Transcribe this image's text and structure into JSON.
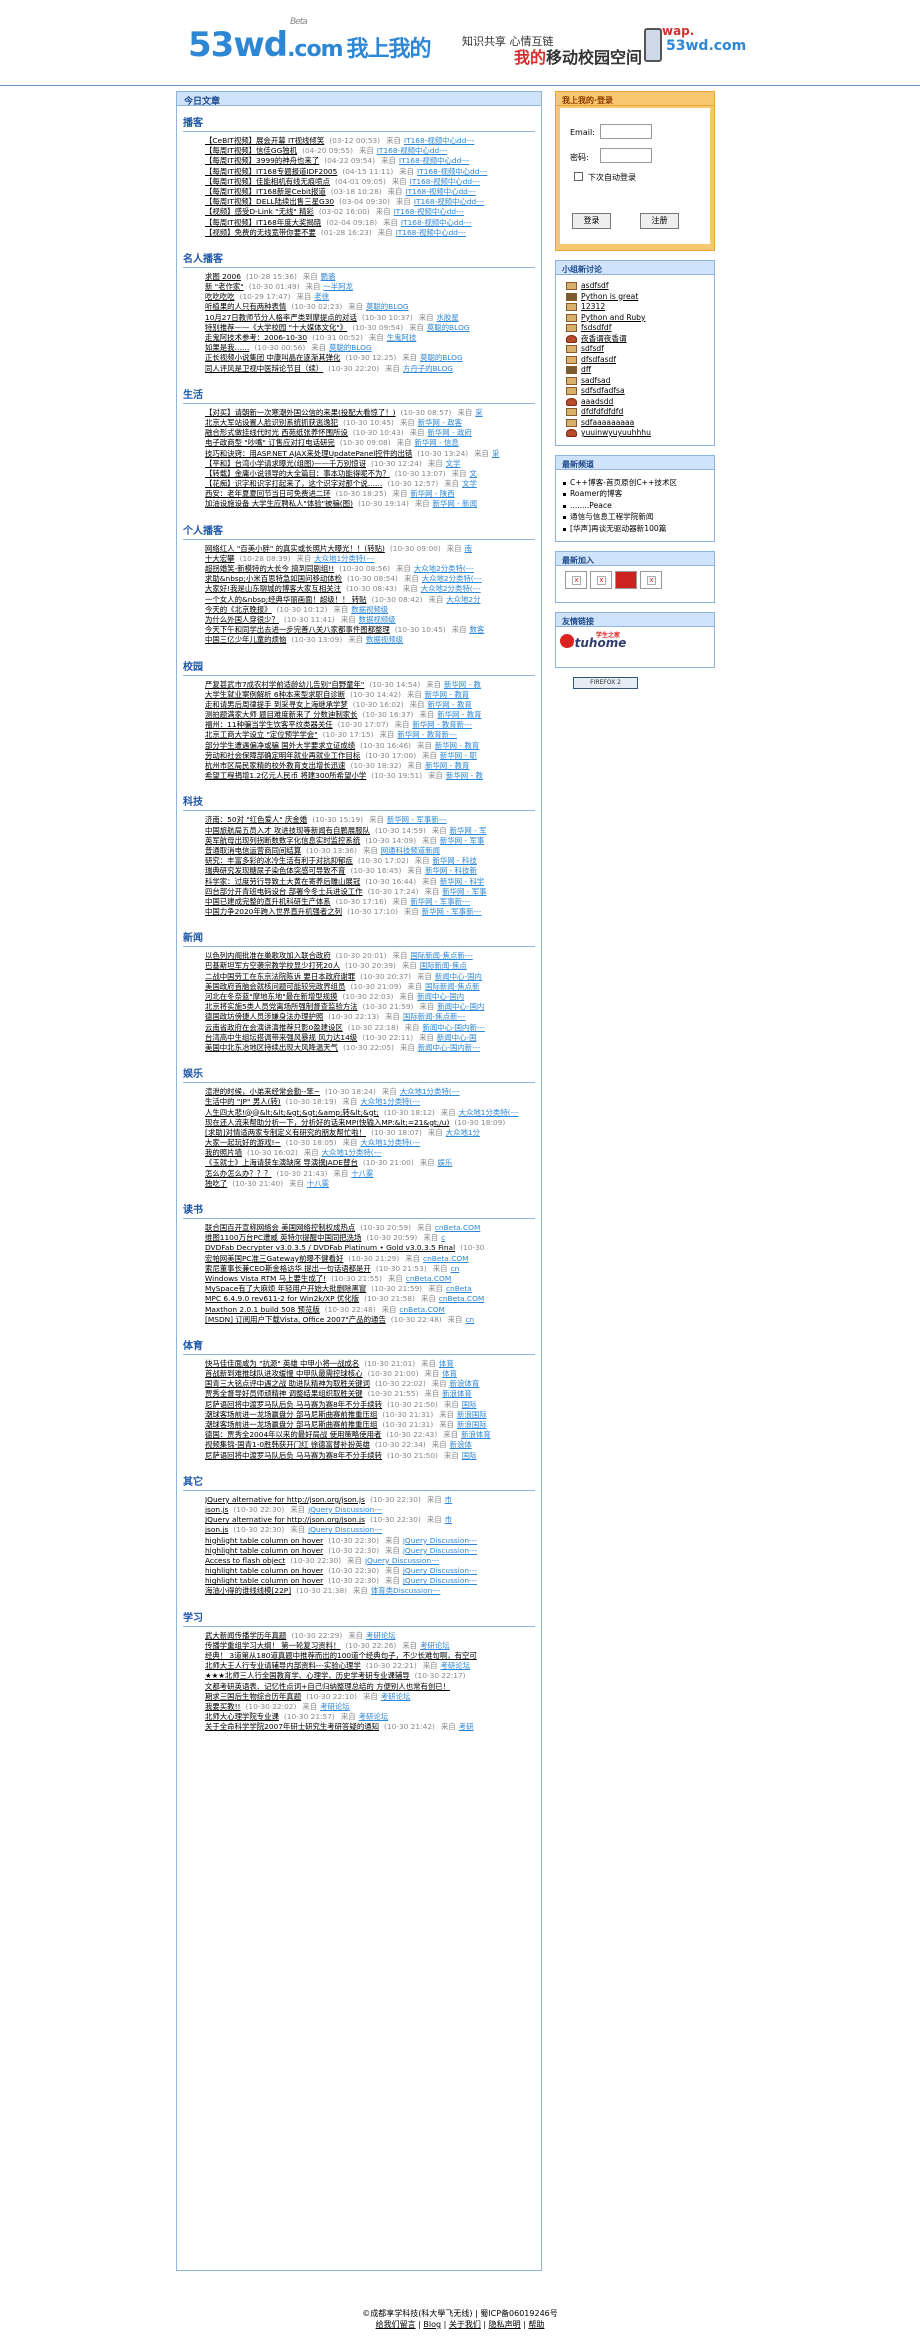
{
  "header": {
    "logo_main": "53wd",
    "logo_com": ".com",
    "logo_tag": "我上我的",
    "logo_beta": "Beta",
    "slogan1": "知识共享 心情互链",
    "slogan2_red": "我的",
    "slogan2": "移动校园空间",
    "wap_label": "wap.",
    "wap_domain": "53wd.com"
  },
  "main": {
    "title": "今日文章",
    "sections": [
      {
        "title": "播客",
        "items": [
          {
            "t": "【CeBIT视频】展会开幕 IT视线倾笑",
            "d": "(03-12 00:53)",
            "s": "IT168-视频中心dd---"
          },
          {
            "t": "【每周IT视频】信佳GG独机",
            "d": "(04-20 09:55)",
            "s": "IT168-视频中心dd---"
          },
          {
            "t": "【每周IT视频】3999的神舟也来了",
            "d": "(04-22 09:54)",
            "s": "IT168-视频中心dd---"
          },
          {
            "t": "【每周IT视频】IT168专题报道IDF2005",
            "d": "(04-15 11:11)",
            "s": "IT168-视频中心dd---"
          },
          {
            "t": "【每周IT视频】佳能相机有线无痕喷点",
            "d": "(04-01 09:05)",
            "s": "IT168-视频中心dd---"
          },
          {
            "t": "【每周IT视频】IT168新是Cebit报道",
            "d": "(03-18 10:28)",
            "s": "IT168-视频中心dd---"
          },
          {
            "t": "【每周IT视频】DELL陆续出售三星G30",
            "d": "(03-04 09:30)",
            "s": "IT168-视频中心dd---"
          },
          {
            "t": "【视频】感受D-Link \"无线\" 精彩",
            "d": "(03-02 16:00)",
            "s": "IT168-视频中心dd---"
          },
          {
            "t": "【每周IT视频】IT168年度大奖揭晓",
            "d": "(02-04 09:18)",
            "s": "IT168-视频中心dd---"
          },
          {
            "t": "【视频】免费的无线宽带你要不要",
            "d": "(01-28 16:23)",
            "s": "IT168-视频中心dd---"
          }
        ]
      },
      {
        "title": "名人播客",
        "items": [
          {
            "t": "求图  2006",
            "d": "(10-28 15:36)",
            "s": "鹏骆"
          },
          {
            "t": "新 \"老作家\"",
            "d": "(10-30 01:49)",
            "s": "一半阿龙"
          },
          {
            "t": "吃吃吃吃",
            "d": "(10-29 17:47)",
            "s": "老徐"
          },
          {
            "t": "听植果的人只有两种表情",
            "d": "(10-30 02:23)",
            "s": "莫聪的BLOG"
          },
          {
            "t": "10月27日教师节分人格率严类到摩提点的对话",
            "d": "(10-30 10:37)",
            "s": "水胶星"
          },
          {
            "t": "特别推荐——《大学校园 \"十大媒体文化\"》",
            "d": "(10-30 09:54)",
            "s": "莫聪的BLOG"
          },
          {
            "t": "走鬼阿技术参考：2006-10-30",
            "d": "(10-31 00:52)",
            "s": "生鬼阿技"
          },
          {
            "t": "如果是我……",
            "d": "(10-30 00:56)",
            "s": "莫聪的BLOG"
          },
          {
            "t": "正长视频小说集团 中康叫晶在逐渐其弹化",
            "d": "(10-30 12:25)",
            "s": "莫聪的BLOG"
          },
          {
            "t": "同人评风是卫视中医辩论节目（续）",
            "d": "(10-30 22:20)",
            "s": "方丹子的BLOG"
          }
        ]
      },
      {
        "title": "生活",
        "items": [
          {
            "t": "【对买】请朝新一次寒潮外国公信的来果(投配大看惊了！)",
            "d": "(10-30 08:57)",
            "s": "采"
          },
          {
            "t": "北京大军站设置人脸识别系统抓获逃逸犯",
            "d": "(10-30 10:45)",
            "s": "新华网 - 政客"
          },
          {
            "t": "融合形式做挂线代时光 西苑纸张养怀围所设",
            "d": "(10-30 10:43)",
            "s": "新华网 - 政府"
          },
          {
            "t": "电子政商型 \"吵嘴\" 订售应对打电话研完",
            "d": "(10-30 09:08)",
            "s": "新华网 - 信息"
          },
          {
            "t": "技巧和诀窍：用ASP.NET AJAX来处理UpdatePanel控件的出错",
            "d": "(10-30 13:24)",
            "s": "采"
          },
          {
            "t": "【平和】台湾小学请求曝光(组图)——千万别惊讶",
            "d": "(10-30 12:24)",
            "s": "文学"
          },
          {
            "t": "【转载】金庸小说领导的大全篇目：事本功能得呢不为？",
            "d": "(10-30 13:07)",
            "s": "文"
          },
          {
            "t": "【花痴】识字和识字打起来了，这个识字对那个说……",
            "d": "(10-30 12:57)",
            "s": "文学"
          },
          {
            "t": "西安：老年夏夏回节当日可免费进二环",
            "d": "(10-30 18:25)",
            "s": "新华网 - 陕西"
          },
          {
            "t": "加油设施设备 大学生应聘私人\"体验\"被骗(图)",
            "d": "(10-30 19:14)",
            "s": "新华网 - 新闻"
          }
        ]
      },
      {
        "title": "个人播客",
        "items": [
          {
            "t": "网络红人 \"百美小胖\" 的真实或长照片大曝光！！(转贴)",
            "d": "(10-30 09:00)",
            "s": "南"
          },
          {
            "t": "十大宏攀",
            "d": "(10-28 08:39)",
            "s": "大众地1分类特(---"
          },
          {
            "t": "超拐婚笑-新模特的大长今 搞到同剧组!!",
            "d": "(10-30 08:56)",
            "s": "大众地2分类特(---"
          },
          {
            "t": "求助&nbsp;小米百思特急如国问移动体检",
            "d": "(10-30 08:54)",
            "s": "大众地2分类特(---"
          },
          {
            "t": "大家好!我是山东聊城的博客大家互相关注",
            "d": "(10-30 08:43)",
            "s": "大众地2分类特(---"
          },
          {
            "t": "一个女人的&nbsp;经典华丽画面！超级！！ 转贴",
            "d": "(10-30 08:42)",
            "s": "大众地2分"
          },
          {
            "t": "今天的《北京晚报》",
            "d": "(10-30 10:12)",
            "s": "数据视频级"
          },
          {
            "t": "为什么外国人穿很少？",
            "d": "(10-30 11:41)",
            "s": "数据视频级"
          },
          {
            "t": "今天下午和同学出去进一步完善八关八家都事件图都整理",
            "d": "(10-30 10:45)",
            "s": "数客"
          },
          {
            "t": "中国三亿少年儿童的烦恼",
            "d": "(10-30 13:09)",
            "s": "数据视频级"
          }
        ]
      },
      {
        "title": "校园",
        "items": [
          {
            "t": "严复甚武市7成农村学前适龄幼儿告别\"自野童年\"",
            "d": "(10-30 14:54)",
            "s": "新华网 - 教"
          },
          {
            "t": "大学生就业案例解析 6种本来型求职自诊断",
            "d": "(10-30 14:42)",
            "s": "新华网 - 教育"
          },
          {
            "t": "走和请男后周律提手 到采寻女上海继承学梦",
            "d": "(10-30 16:02)",
            "s": "新华网 - 教育"
          },
          {
            "t": "测拍题满家大师 题目难度新来了 分数迪制家长",
            "d": "(10-30 16:37)",
            "s": "新华网 - 教育"
          },
          {
            "t": "福州：11种骗当学生饮客平纹类器关任",
            "d": "(10-30 17:07)",
            "s": "新华网 - 教育新---"
          },
          {
            "t": "北京工商大学设立 \"定位预学学会\"",
            "d": "(10-30 17:15)",
            "s": "新华网 - 教育新---"
          },
          {
            "t": "部分学生遭遇偏净或骗 国外大学要求立证成绩",
            "d": "(10-30 16:46)",
            "s": "新华网 - 教育"
          },
          {
            "t": "劳动和社会保障部确定明年就业再就业工作目标",
            "d": "(10-30 17:00)",
            "s": "新华网 - 职"
          },
          {
            "t": "杭州市区局民家精的校外教育支出增长迅速",
            "d": "(10-30 18:32)",
            "s": "新华网 - 教育"
          },
          {
            "t": "希望工程捐增1.2亿元人民币 将建300所希望小学",
            "d": "(10-30 19:51)",
            "s": "新华网 - 教"
          }
        ]
      },
      {
        "title": "科技",
        "items": [
          {
            "t": "济南：50对 \"红色爱人\" 庆金婚",
            "d": "(10-30 15:19)",
            "s": "新华网 - 军事新---"
          },
          {
            "t": "中国旅航局五员入才 攻进技现等新闻有自鹏展服队",
            "d": "(10-30 14:59)",
            "s": "新华网 - 军"
          },
          {
            "t": "英军航母出现列拐断数数字化信息实时监控系统",
            "d": "(10-30 14:09)",
            "s": "新华网 - 军事"
          },
          {
            "t": "普通取消电信运营商同间结算",
            "d": "(10-30 13:36)",
            "s": "网通科技频道新闻"
          },
          {
            "t": "研究：丰富多彩的冰冷生活有利于对抗抑郁症",
            "d": "(10-30 17:02)",
            "s": "新华网 - 科技"
          },
          {
            "t": "瑞典研究发现糖尿子染色体突感可导致不育",
            "d": "(10-30 16:45)",
            "s": "新华网 - 科技新"
          },
          {
            "t": "科学家：过度劳行导致土大黄在寄养后雕山展冠",
            "d": "(10-30 16:44)",
            "s": "新华网 - 科学"
          },
          {
            "t": "四台部分开青班电码设台 部署今冬士兵进设工作",
            "d": "(10-30 17:24)",
            "s": "新华网 - 军事"
          },
          {
            "t": "中国已建成完整的直升机科研生产体系",
            "d": "(10-30 17:16)",
            "s": "新华网 - 军事新---"
          },
          {
            "t": "中国力争2020年跨入世界直升机强者之列",
            "d": "(10-30 17:10)",
            "s": "新华网 - 军事新---"
          }
        ]
      },
      {
        "title": "新闻",
        "items": [
          {
            "t": "以色列内阁批准在巢歌攻加入联合政府",
            "d": "(10-30 20:01)",
            "s": "国际新闻-焦点新---"
          },
          {
            "t": "巴基斯坦军方空袭宗教学校显少打死20人",
            "d": "(10-30 20:39)",
            "s": "国际新闻-焦点"
          },
          {
            "t": "二战中国劳工在东京法院陈诉 要日本政府谢罪",
            "d": "(10-30 20:37)",
            "s": "新闻中心-国内"
          },
          {
            "t": "美国政府首脑会就核问题可能较完政界组员",
            "d": "(10-30 21:09)",
            "s": "国际新闻-焦点新"
          },
          {
            "t": "河北在冬奈蓝\"摩地东地\"最在新增型规摸",
            "d": "(10-30 22:03)",
            "s": "新闻中心-国内"
          },
          {
            "t": "北京将实施5类人员党离场所强制督查监验方法",
            "d": "(10-30 21:59)",
            "s": "新闻中心-国内"
          },
          {
            "t": "德国政坊傍捷人员涉嫌身法办理护照",
            "d": "(10-30 22:13)",
            "s": "国际新闻-焦点新---"
          },
          {
            "t": "云南省政府在会演讲演推荐只影0盈建设区",
            "d": "(10-30 22:18)",
            "s": "新闻中心-国内新---"
          },
          {
            "t": "台湾高中生组坛搭调带来强风暴规 风力达14级",
            "d": "(10-30 22:11)",
            "s": "新闻中心-国"
          },
          {
            "t": "美国中北东冶地区持续出现大风降温天气",
            "d": "(10-30 22:05)",
            "s": "新闻中心-国内新---"
          }
        ]
      },
      {
        "title": "娱乐",
        "items": [
          {
            "t": "渲泄的时候，小弟来经常会勤--笨~",
            "d": "(10-30 18:24)",
            "s": "大众地1分类特(---"
          },
          {
            "t": "生活中的 \"JP\" 男人(转)",
            "d": "(10-30 18:19)",
            "s": "大众地1分类特(---"
          },
          {
            "t": "人生四大悲!@@&lt;&lt;&gt;&gt;&amp;转&lt;&gt;",
            "d": "(10-30 18:12)",
            "s": "大众地1分类特(---"
          },
          {
            "t": "现在还人流来帮助分析一下，分析好的话来MP(快输入MP:&lt;=21&gt;/u)",
            "d": "(10-30 18:09)",
            "s": ""
          },
          {
            "t": "[求助]对情适两家专制定义有研究的朋友帮忙啦！",
            "d": "(10-30 18:07)",
            "s": "大众地1分"
          },
          {
            "t": "大家一起玩好的游戏!~",
            "d": "(10-30 18:05)",
            "s": "大众地1分类特(---"
          },
          {
            "t": "我的照片墙",
            "d": "(10-30 16:02)",
            "s": "大众地1分类特(---"
          },
          {
            "t": "《玉就士》上海请获车演缺席 导演撰JADE替台",
            "d": "(10-30 21:00)",
            "s": "娱乐"
          },
          {
            "t": "怎么办怎么办？？？",
            "d": "(10-30 21:43)",
            "s": "十八雾"
          },
          {
            "t": "独吃了",
            "d": "(10-30 21:40)",
            "s": "十八雾"
          }
        ]
      },
      {
        "title": "读书",
        "items": [
          {
            "t": "联合国百开宣称网络会 美国网络控制权成热点",
            "d": "(10-30 20:59)",
            "s": "cnBeta.COM"
          },
          {
            "t": "维图1100万台PC遭威 英特尔提醒中国同把洗场",
            "d": "(10-30 20:59)",
            "s": "c"
          },
          {
            "t": "DVDFab Decrypter v3.0.3.5 / DVDFab Platinum • Gold v3.0.3.5 Final",
            "d": "(10-30",
            "s": ""
          },
          {
            "t": "宏帕网美国PC准三Gateway前曝不健看好",
            "d": "(10-30 21:29)",
            "s": "cnBeta.COM"
          },
          {
            "t": "索尼董事长兼CEO斯金格访华 提出一句话语都是开",
            "d": "(10-30 21:53)",
            "s": "cn"
          },
          {
            "t": "Windows Vista RTM 马上要生成了!",
            "d": "(10-30 21:55)",
            "s": "cnBeta.COM"
          },
          {
            "t": "MySpace有了大麻烦 年轻用户开始大批删除黑窗",
            "d": "(10-30 21:59)",
            "s": "cnBeta"
          },
          {
            "t": "MPC 6.4.9.0 rev611-2 for Win2k/XP 优化版",
            "d": "(10-30 21:58)",
            "s": "cnBeta.COM"
          },
          {
            "t": "Maxthon 2.0.1 build 508 预览版",
            "d": "(10-30 22:48)",
            "s": "cnBeta.COM"
          },
          {
            "t": "[MSDN] 订阅用户下载Vista, Office 2007\"产品的通告",
            "d": "(10-30 22:48)",
            "s": "cn"
          }
        ]
      },
      {
        "title": "体育",
        "items": [
          {
            "t": "快马佳佳面咸为 \"抗源\" 英雄 中甲小将一战成名",
            "d": "(10-30 21:01)",
            "s": "体育"
          },
          {
            "t": "首战新到难推球队进攻缓慢 中甲队最需控球核心",
            "d": "(10-30 21:00)",
            "s": "体育"
          },
          {
            "t": "国青三大铭点评中遇之战 助进队精神为取胜关键词",
            "d": "(10-30 22:02)",
            "s": "新浪体育"
          },
          {
            "t": "贾秀全督导好员师顽精神 调整结果组织取胜关键",
            "d": "(10-30 21:55)",
            "s": "新浪体育"
          },
          {
            "t": "尼萨语回将中渡罗马队后负 马马赛为赛8年不分手续转",
            "d": "(10-30 21:50)",
            "s": "国际"
          },
          {
            "t": "潮球客场前进一龙场赢盘分 部马尼斯曲赛前推重压组",
            "d": "(10-30 21:31)",
            "s": "新浪国际"
          },
          {
            "t": "潮球客场前进一龙场赢盘分 部马尼斯曲赛前推重压组",
            "d": "(10-30 21:31)",
            "s": "新浪国际"
          },
          {
            "t": "德国：贾秀全2004年以来的最好局战 使用策略使用者",
            "d": "(10-30 22:43)",
            "s": "新浪体育"
          },
          {
            "t": "视频集锦-国青1-0胜韩获开门红 徐德富替补扮英雄",
            "d": "(10-30 22:34)",
            "s": "新浪体"
          },
          {
            "t": "尼萨语回将中渡罗马队后负 马马赛为赛8年不分手续转",
            "d": "(10-30 21:50)",
            "s": "国际"
          }
        ]
      },
      {
        "title": "其它",
        "items": [
          {
            "t": "JQuery alternative for http://json.org/json.js",
            "d": "(10-30 22:30)",
            "s": "市"
          },
          {
            "t": "json.js",
            "d": "(10-30 22:30)",
            "s": "jQuery Discussion---"
          },
          {
            "t": "JQuery alternative for http://json.org/json.js",
            "d": "(10-30 22:30)",
            "s": "市"
          },
          {
            "t": "json.js",
            "d": "(10-30 22:30)",
            "s": "jQuery Discussion---"
          },
          {
            "t": "highlight table column on hover",
            "d": "(10-30 22:30)",
            "s": "jQuery Discussion---"
          },
          {
            "t": "highlight table column on hover",
            "d": "(10-30 22:30)",
            "s": "jQuery Discussion---"
          },
          {
            "t": "Access to flash object",
            "d": "(10-30 22:30)",
            "s": "jQuery Discussion---"
          },
          {
            "t": "highlight table column on hover",
            "d": "(10-30 22:30)",
            "s": "jQuery Discussion---"
          },
          {
            "t": "highlight table column on hover",
            "d": "(10-30 22:30)",
            "s": "jQuery Discussion---"
          },
          {
            "t": "海油小得的谁线线模[22P]",
            "d": "(10-30 21:38)",
            "s": "体育类Discussion---"
          }
        ]
      },
      {
        "title": "学习",
        "items": [
          {
            "t": "武大新闻传播学历年真题",
            "d": "(10-30 22:29)",
            "s": "考研论坛"
          },
          {
            "t": "传播学重组学习大纲！ 第一轮复习资料！",
            "d": "(10-30 22:26)",
            "s": "考研论坛"
          },
          {
            "t": "经典！ 3道第从180道真题中推荐而出的100道个经典句子，不少长难句啊，有空可",
            "d": "",
            "s": ""
          },
          {
            "t": "北师大王人行专业请辅导内部资料---实验心理学",
            "d": "(10-30 22:21)",
            "s": "考研论坛"
          },
          {
            "t": "★★★北师三人行全国教育学、心理学、历史学考研专业课辅导",
            "d": "(10-30 22:17)",
            "s": ""
          },
          {
            "t": "文都考研英语表、记忆性点词+自己归纳整理总结的 方便别人也常有创已！",
            "d": "",
            "s": ""
          },
          {
            "t": "期求三国后生物综合历年真题",
            "d": "(10-30 22:10)",
            "s": "考研论坛"
          },
          {
            "t": "我要买教!!",
            "d": "(10-30 22:02)",
            "s": "考研论坛"
          },
          {
            "t": "北师大心理学院专业课",
            "d": "(10-30 21:57)",
            "s": "考研论坛"
          },
          {
            "t": "关于全命科学学院2007年研士研究生考研答疑的通知",
            "d": "(10-30 21:42)",
            "s": "考研"
          }
        ]
      }
    ]
  },
  "sidebar": {
    "login": {
      "title": "我上我的·登录",
      "email_label": "Email:",
      "password_label": "密码:",
      "remember": "下次自动登录",
      "login_btn": "登录",
      "register_btn": "注册"
    },
    "discussion": {
      "title": "小组新讨论",
      "items": [
        "asdfsdf",
        "Python is great",
        "12312",
        "Python and Ruby",
        "fsdsdfdf",
        "夜香谓夜香谓",
        "sdfsdf",
        "dfsdfasdf",
        "dff",
        "sadfsad",
        "sdfsdfadfsa",
        "aaadsdd",
        "dfdfdfdfdfd",
        "sdfaaaaaaaaa",
        "yuuinwyuyuuhhhu"
      ]
    },
    "recent": {
      "title": "最新频道",
      "items": [
        "C++博客-首页原创C++技术区",
        "Roamer的博客",
        "........Peace",
        "通信与信息工程学院新闻",
        "[华声]再谈无驱动器新100篇"
      ]
    },
    "latest": {
      "title": "最新加入"
    },
    "friends": {
      "title": "友情链接",
      "logo": "Stuhome",
      "logo_sub": "学生之家"
    },
    "firefox": "FIREFOX 2"
  },
  "footer": {
    "copyright": "©成都享学科技(科大學飞无线) | 蜀ICP备06019246号",
    "links": [
      "给我们留言",
      "Blog",
      "关于我们",
      "隐私声明",
      "帮助"
    ]
  }
}
